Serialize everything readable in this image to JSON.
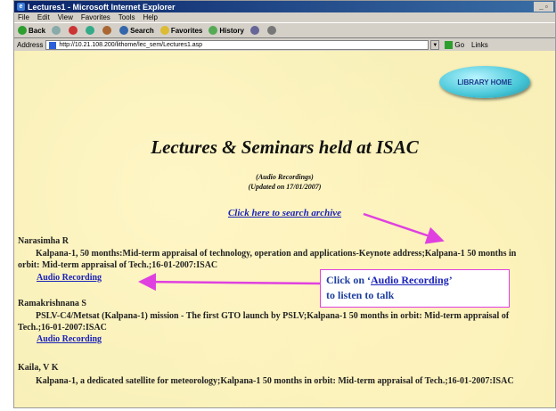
{
  "window": {
    "title": "Lectures1 - Microsoft Internet Explorer"
  },
  "menu": [
    "File",
    "Edit",
    "View",
    "Favorites",
    "Tools",
    "Help"
  ],
  "toolbar": {
    "back": "Back",
    "search": "Search",
    "favorites": "Favorites",
    "history": "History"
  },
  "address": {
    "label": "Address",
    "url": "http://10.21.108.200/lithome/lec_sem/Lectures1.asp",
    "go": "Go",
    "links": "Links"
  },
  "page": {
    "library_button": "LIBRARY HOME",
    "title": "Lectures & Seminars held at ISAC",
    "subtitle_line1": "(Audio Recordings)",
    "subtitle_line2": "(Updated on 17/01/2007)",
    "search_link": "Click here to search archive",
    "entries": [
      {
        "name": "Narasimha R",
        "desc": "Kalpana-1, 50 months:Mid-term appraisal of technology, operation and applications-Keynote address;Kalpana-1 50 months in orbit: Mid-term appraisal of Tech.;16-01-2007:ISAC",
        "audio": "Audio Recording"
      },
      {
        "name": "Ramakrishnana S",
        "desc": "PSLV-C4/Metsat (Kalpana-1) mission - The first GTO launch by PSLV;Kalpana-1 50 months in orbit: Mid-term appraisal of Tech.;16-01-2007:ISAC",
        "audio": "Audio Recording"
      },
      {
        "name": "Kaila, V K",
        "desc": "Kalpana-1, a dedicated satellite for meteorology;Kalpana-1 50 months in orbit: Mid-term appraisal of Tech.;16-01-2007:ISAC",
        "audio": ""
      }
    ],
    "callout": {
      "prefix": "Click on ‘",
      "link": "Audio Recording",
      "suffix": "’",
      "line2": "to listen to talk"
    }
  },
  "colors": {
    "page_bg": "#f8f0b8",
    "link": "#1a22b8",
    "arrow": "#e040e0"
  }
}
